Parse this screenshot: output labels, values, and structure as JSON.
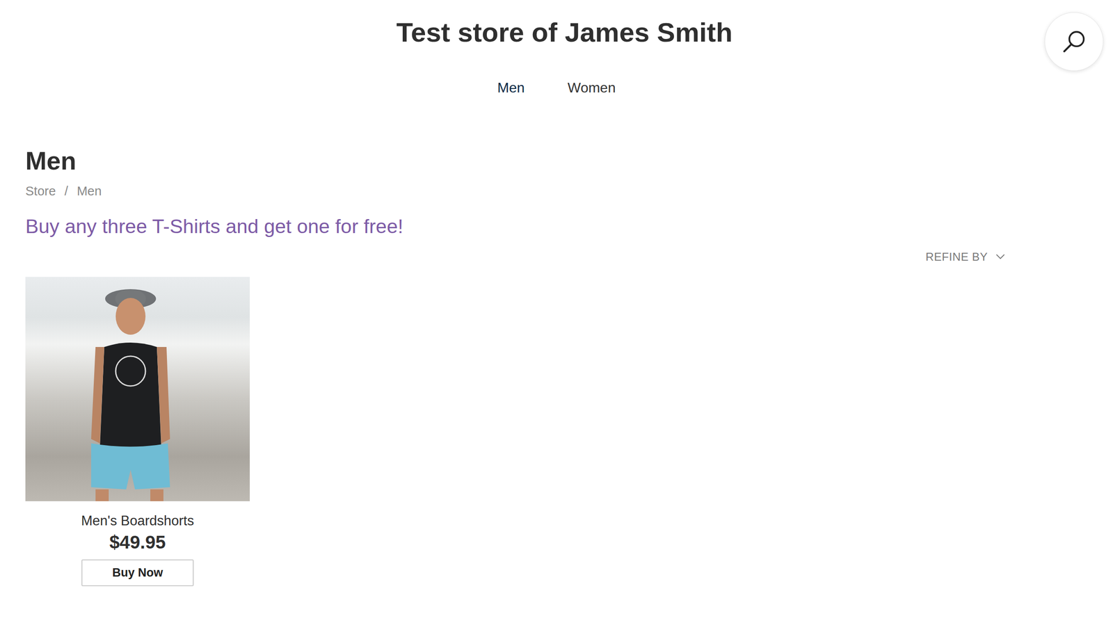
{
  "store": {
    "title": "Test store of James Smith"
  },
  "nav": [
    {
      "label": "Men",
      "selected": true
    },
    {
      "label": "Women",
      "selected": false
    }
  ],
  "page": {
    "heading": "Men",
    "breadcrumb": [
      {
        "label": "Store"
      },
      {
        "label": "Men"
      }
    ],
    "separator": "/",
    "promo": "Buy any three T-Shirts and get one for free!",
    "refine": "REFINE BY"
  },
  "products": [
    {
      "name": "Men's Boardshorts",
      "price": "$49.95",
      "button": "Buy Now"
    }
  ]
}
